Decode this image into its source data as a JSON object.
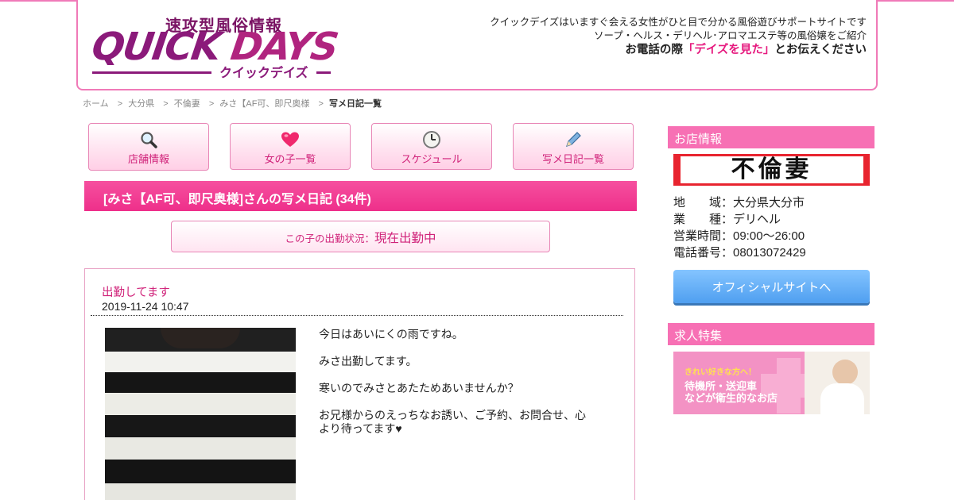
{
  "header": {
    "logo_sub": "速攻型風俗情報",
    "logo_main_a": "QUICK",
    "logo_main_b": "DAYS",
    "logo_kana": "クイックデイズ",
    "desc1": "クイックデイズはいますぐ会える女性がひと目で分かる風俗遊びサポートサイトです",
    "desc2": "ソープ・ヘルス・デリヘル･アロマエステ等の風俗嬢をご紹介",
    "phone_pre": "お電話の際",
    "phone_hl": "「デイズを見た」",
    "phone_post": "とお伝えください"
  },
  "breadcrumb": {
    "sep": ">",
    "items": [
      "ホーム",
      "大分県",
      "不倫妻",
      "みさ【AF可、即尺奥様",
      "写メ日記一覧"
    ]
  },
  "nav": [
    {
      "label": "店舗情報",
      "icon": "search-icon"
    },
    {
      "label": "女の子一覧",
      "icon": "heart-icon"
    },
    {
      "label": "スケジュール",
      "icon": "clock-icon"
    },
    {
      "label": "写メ日記一覧",
      "icon": "pencil-icon"
    }
  ],
  "page_title": "[みさ【AF可、即尺奥様]さんの写メ日記 (34件)",
  "status": {
    "label": "この子の出勤状況：",
    "value": "現在出勤中"
  },
  "diary": {
    "title": "出勤してます",
    "date": "2019-11-24 10:47",
    "body": [
      "今日はあいにくの雨ですね。",
      "みさ出勤してます。",
      "寒いのでみさとあたためあいませんか？",
      "お兄様からのえっちなお誘い、ご予約、お問合せ、心より待ってます♥"
    ]
  },
  "sidebar": {
    "shop_head": "お店情報",
    "shop_name": "不倫妻",
    "info": [
      "地　　域：大分県大分市",
      "業　　種：デリヘル",
      "営業時間：09:00〜26:00",
      "電話番号：08013072429"
    ],
    "official_btn": "オフィシャルサイトへ",
    "recruit_head": "求人特集",
    "recruit_small": "きれい好きな方へ！",
    "recruit_line1": "待機所・送迎車",
    "recruit_line2": "などが衛生的なお店"
  },
  "colors": {
    "accent": "#ee2f8a",
    "border_pink": "#f07ab8",
    "sidebar_head": "#f770b4",
    "button_blue": "#4f9ff0"
  }
}
